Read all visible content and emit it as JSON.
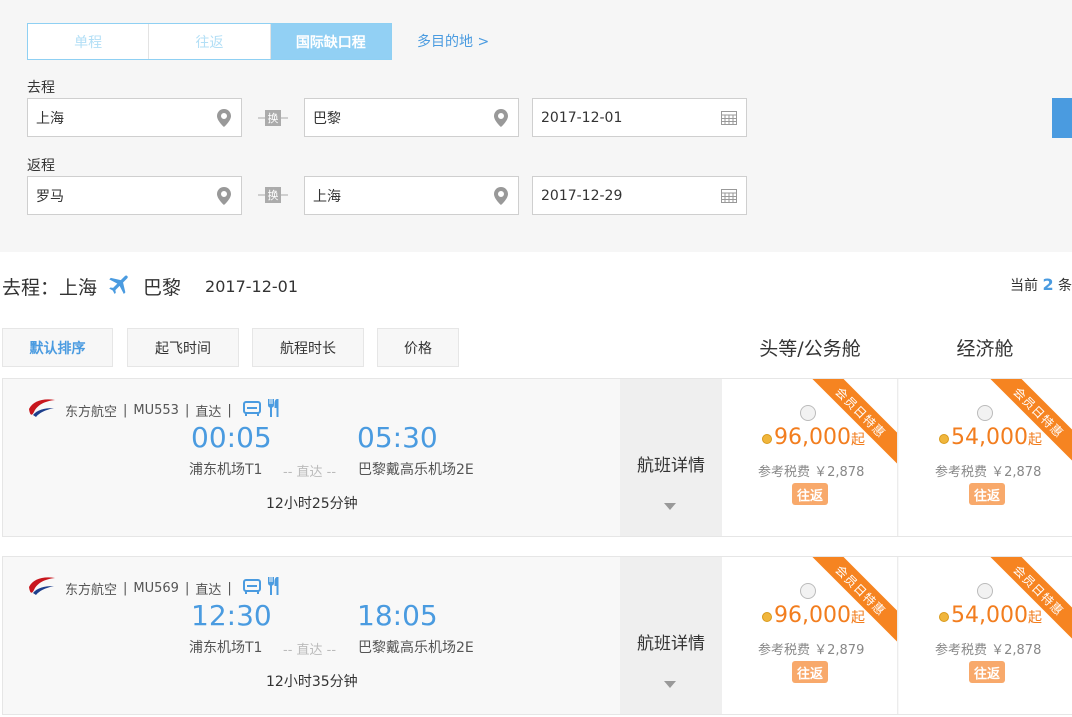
{
  "trip_tabs": [
    {
      "label": "单程",
      "active": false
    },
    {
      "label": "往返",
      "active": false
    },
    {
      "label": "国际缺口程",
      "active": true
    }
  ],
  "multi_destination": "多目的地 >",
  "outbound": {
    "label": "去程",
    "from": "上海",
    "to": "巴黎",
    "date": "2017-12-01"
  },
  "inbound": {
    "label": "返程",
    "from": "罗马",
    "to": "上海",
    "date": "2017-12-29"
  },
  "swap_label": "换",
  "result_header": {
    "prefix": "去程：",
    "from": "上海",
    "to": "巴黎",
    "date": "2017-12-01",
    "count_prefix": "当前",
    "count": "2",
    "count_suffix": "条"
  },
  "sort_buttons": [
    {
      "label": "默认排序",
      "active": true
    },
    {
      "label": "起飞时间",
      "active": false
    },
    {
      "label": "航程时长",
      "active": false
    },
    {
      "label": "价格",
      "active": false
    }
  ],
  "cabin_headers": {
    "first": "头等/公务舱",
    "economy": "经济舱"
  },
  "flights": [
    {
      "airline": "东方航空",
      "flight_no": "MU553",
      "direct": "直达",
      "depart_time": "00:05",
      "arrive_time": "05:30",
      "depart_airport": "浦东机场T1",
      "arrive_airport": "巴黎戴高乐机场2E",
      "via": "-- 直达 --",
      "duration": "12小时25分钟",
      "detail_label": "航班详情",
      "first": {
        "price": "96,000",
        "suffix": "起",
        "tax": "参考税费 ￥2,878",
        "badge": "往返",
        "ribbon": "会员日特惠"
      },
      "economy": {
        "price": "54,000",
        "suffix": "起",
        "tax": "参考税费 ￥2,878",
        "badge": "往返",
        "ribbon": "会员日特惠"
      }
    },
    {
      "airline": "东方航空",
      "flight_no": "MU569",
      "direct": "直达",
      "depart_time": "12:30",
      "arrive_time": "18:05",
      "depart_airport": "浦东机场T1",
      "arrive_airport": "巴黎戴高乐机场2E",
      "via": "-- 直达 --",
      "duration": "12小时35分钟",
      "detail_label": "航班详情",
      "first": {
        "price": "96,000",
        "suffix": "起",
        "tax": "参考税费 ￥2,879",
        "badge": "往返",
        "ribbon": "会员日特惠"
      },
      "economy": {
        "price": "54,000",
        "suffix": "起",
        "tax": "参考税费 ￥2,878",
        "badge": "往返",
        "ribbon": "会员日特惠"
      }
    }
  ],
  "colors": {
    "accent": "#4a9be0",
    "price": "#f27d1e",
    "ribbon": "#f68421",
    "tab_active": "#92d0f4"
  },
  "icons": [
    "location-pin-icon",
    "calendar-icon",
    "swap-icon",
    "plane-icon",
    "airline-logo-icon",
    "seat-icon",
    "meal-icon",
    "chevron-down-icon"
  ]
}
